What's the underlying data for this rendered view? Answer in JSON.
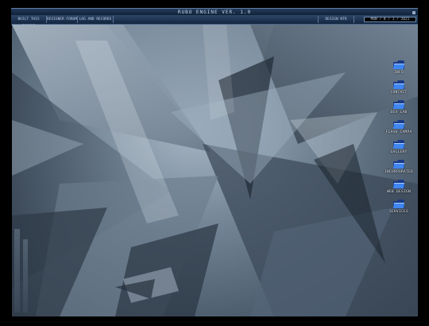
{
  "window": {
    "title": "RUBO ENGINE VER. 1.0"
  },
  "menu": {
    "items": [
      "BUILT THIS ENGINE",
      "DESIGNER FORUM",
      "LOG AND RECORDS",
      "DESIGN NTR"
    ],
    "clock": "MON / 8 / 1 / 2021"
  },
  "desktop": {
    "icons": [
      {
        "label": "INFO",
        "icon": "folder-icon"
      },
      {
        "label": "CONTACT",
        "icon": "folder-icon"
      },
      {
        "label": "DEV LAB",
        "icon": "folder-icon"
      },
      {
        "label": "FLASH CAMPA",
        "icon": "folder-icon"
      },
      {
        "label": "GALLERY",
        "icon": "folder-icon"
      },
      {
        "label": "INCORPORATED",
        "icon": "folder-icon"
      },
      {
        "label": "WEB DESIGN",
        "icon": "folder-icon"
      },
      {
        "label": "SERVICES",
        "icon": "folder-icon"
      }
    ]
  },
  "colors": {
    "bar": "#1a2e4a",
    "folder": "#2f6fd8",
    "wallpaper": "#5d6f80"
  }
}
